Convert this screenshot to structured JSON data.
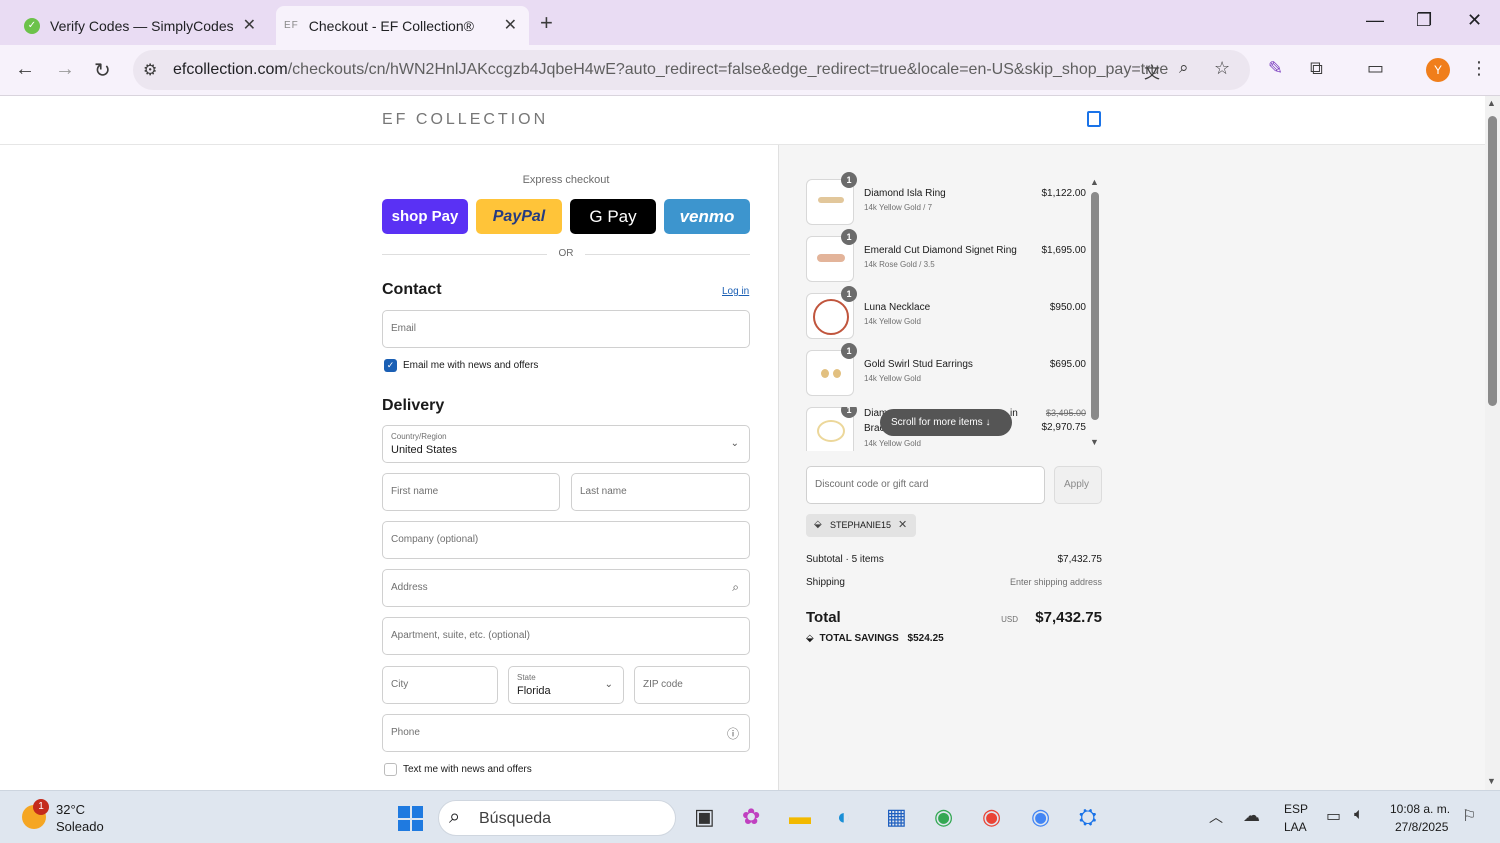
{
  "browser": {
    "tabs": [
      {
        "title": "Verify Codes — SimplyCodes",
        "icon": "simplycodes-icon"
      },
      {
        "title": "Checkout - EF Collection®",
        "icon": "ef-icon",
        "favicon_text": "EF"
      }
    ],
    "url_host": "efcollection.com",
    "url_path": "/checkouts/cn/hWN2HnlJAKccgzb4JqbeH4wE?auto_redirect=false&edge_redirect=true&locale=en-US&skip_shop_pay=true",
    "profile_initial": "Y"
  },
  "store": {
    "logo": "EF COLLECTION"
  },
  "express": {
    "label": "Express checkout",
    "buttons": [
      "shop Pay",
      "PayPal",
      "G Pay",
      "venmo"
    ],
    "or": "OR",
    "colors": {
      "shop": "#5a31f4",
      "paypal": "#ffc439",
      "gpay": "#000000",
      "venmo": "#3d95ce"
    }
  },
  "contact": {
    "heading": "Contact",
    "login": "Log in",
    "email_placeholder": "Email",
    "news_label": "Email me with news and offers",
    "news_checked": true
  },
  "delivery": {
    "heading": "Delivery",
    "country_label": "Country/Region",
    "country_value": "United States",
    "first_name": "First name",
    "last_name": "Last name",
    "company": "Company (optional)",
    "address": "Address",
    "apartment": "Apartment, suite, etc. (optional)",
    "city": "City",
    "state_label": "State",
    "state_value": "Florida",
    "zip": "ZIP code",
    "phone": "Phone",
    "text_label": "Text me with news and offers"
  },
  "order": {
    "items": [
      {
        "qty": "1",
        "name": "Diamond Isla Ring",
        "variant": "14k Yellow Gold / 7",
        "price": "$1,122.00"
      },
      {
        "qty": "1",
        "name": "Emerald Cut Diamond Signet Ring",
        "variant": "14k Rose Gold / 3.5",
        "price": "$1,695.00"
      },
      {
        "qty": "1",
        "name": "Luna Necklace",
        "variant": "14k Yellow Gold",
        "price": "$950.00"
      },
      {
        "qty": "1",
        "name": "Gold Swirl Stud Earrings",
        "variant": "14k Yellow Gold",
        "price": "$695.00"
      },
      {
        "qty": "1",
        "name_part1": "Diam",
        "name_part2": "in",
        "name_line2": "Brac",
        "variant": "14k Yellow Gold",
        "original_price": "$3,495.00",
        "price": "$2,970.75"
      }
    ],
    "scroll_hint": "Scroll for more items",
    "discount_placeholder": "Discount code or gift card",
    "apply": "Apply",
    "applied_code": "STEPHANIE15",
    "subtotal_label": "Subtotal · 5 items",
    "subtotal_value": "$7,432.75",
    "shipping_label": "Shipping",
    "shipping_value": "Enter shipping address",
    "total_label": "Total",
    "currency": "USD",
    "total_value": "$7,432.75",
    "savings_label": "TOTAL SAVINGS",
    "savings_value": "$524.25"
  },
  "taskbar": {
    "weather_temp": "32°C",
    "weather_desc": "Soleado",
    "weather_badge": "1",
    "search_placeholder": "Búsqueda",
    "lang1": "ESP",
    "lang2": "LAA",
    "time": "10:08 a. m.",
    "date": "27/8/2025"
  }
}
